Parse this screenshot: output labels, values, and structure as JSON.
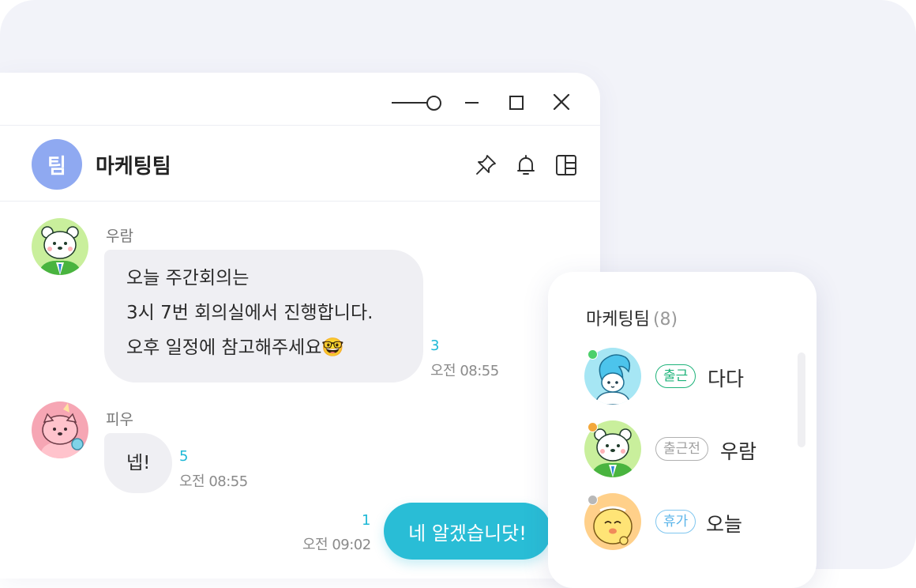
{
  "window": {
    "controls": [
      "opacity-slider",
      "minimize",
      "maximize",
      "close"
    ]
  },
  "header": {
    "avatar_text": "팀",
    "avatar_color": "#8fa9f1",
    "title": "마케팅팀",
    "icons": [
      "pin-icon",
      "bell-icon",
      "panel-layout-icon"
    ]
  },
  "messages": [
    {
      "sender": "우람",
      "avatar": "polar-bear-character",
      "lines": [
        "오늘 주간회의는",
        "3시 7번 회의실에서 진행합니다.",
        "오후 일정에 참고해주세요🤓"
      ],
      "read_count": "3",
      "time": "오전 08:55"
    },
    {
      "sender": "피우",
      "avatar": "pink-dog-character",
      "lines": [
        "넵!"
      ],
      "read_count": "5",
      "time": "오전 08:55"
    }
  ],
  "my_message": {
    "text": "네 알겠습니닷!",
    "read_count": "1",
    "time": "오전 09:02"
  },
  "members_panel": {
    "title": "마케팅팀",
    "count": "(8)",
    "members": [
      {
        "name": "다다",
        "status": "출근",
        "status_color": "#1eb37a",
        "dot_color": "#4cd06b",
        "avatar": "blue-ghost-character"
      },
      {
        "name": "우람",
        "status": "출근전",
        "status_color": "#a0a0a0",
        "dot_color": "#f3a83b",
        "avatar": "polar-bear-character"
      },
      {
        "name": "오늘",
        "status": "휴가",
        "status_color": "#5bb5ea",
        "dot_color": "#b8b8b8",
        "avatar": "yellow-character"
      }
    ]
  },
  "colors": {
    "accent": "#29bdd6",
    "read_count": "#1db8d6",
    "bubble": "#efeff3",
    "background": "#f2f3f9"
  }
}
